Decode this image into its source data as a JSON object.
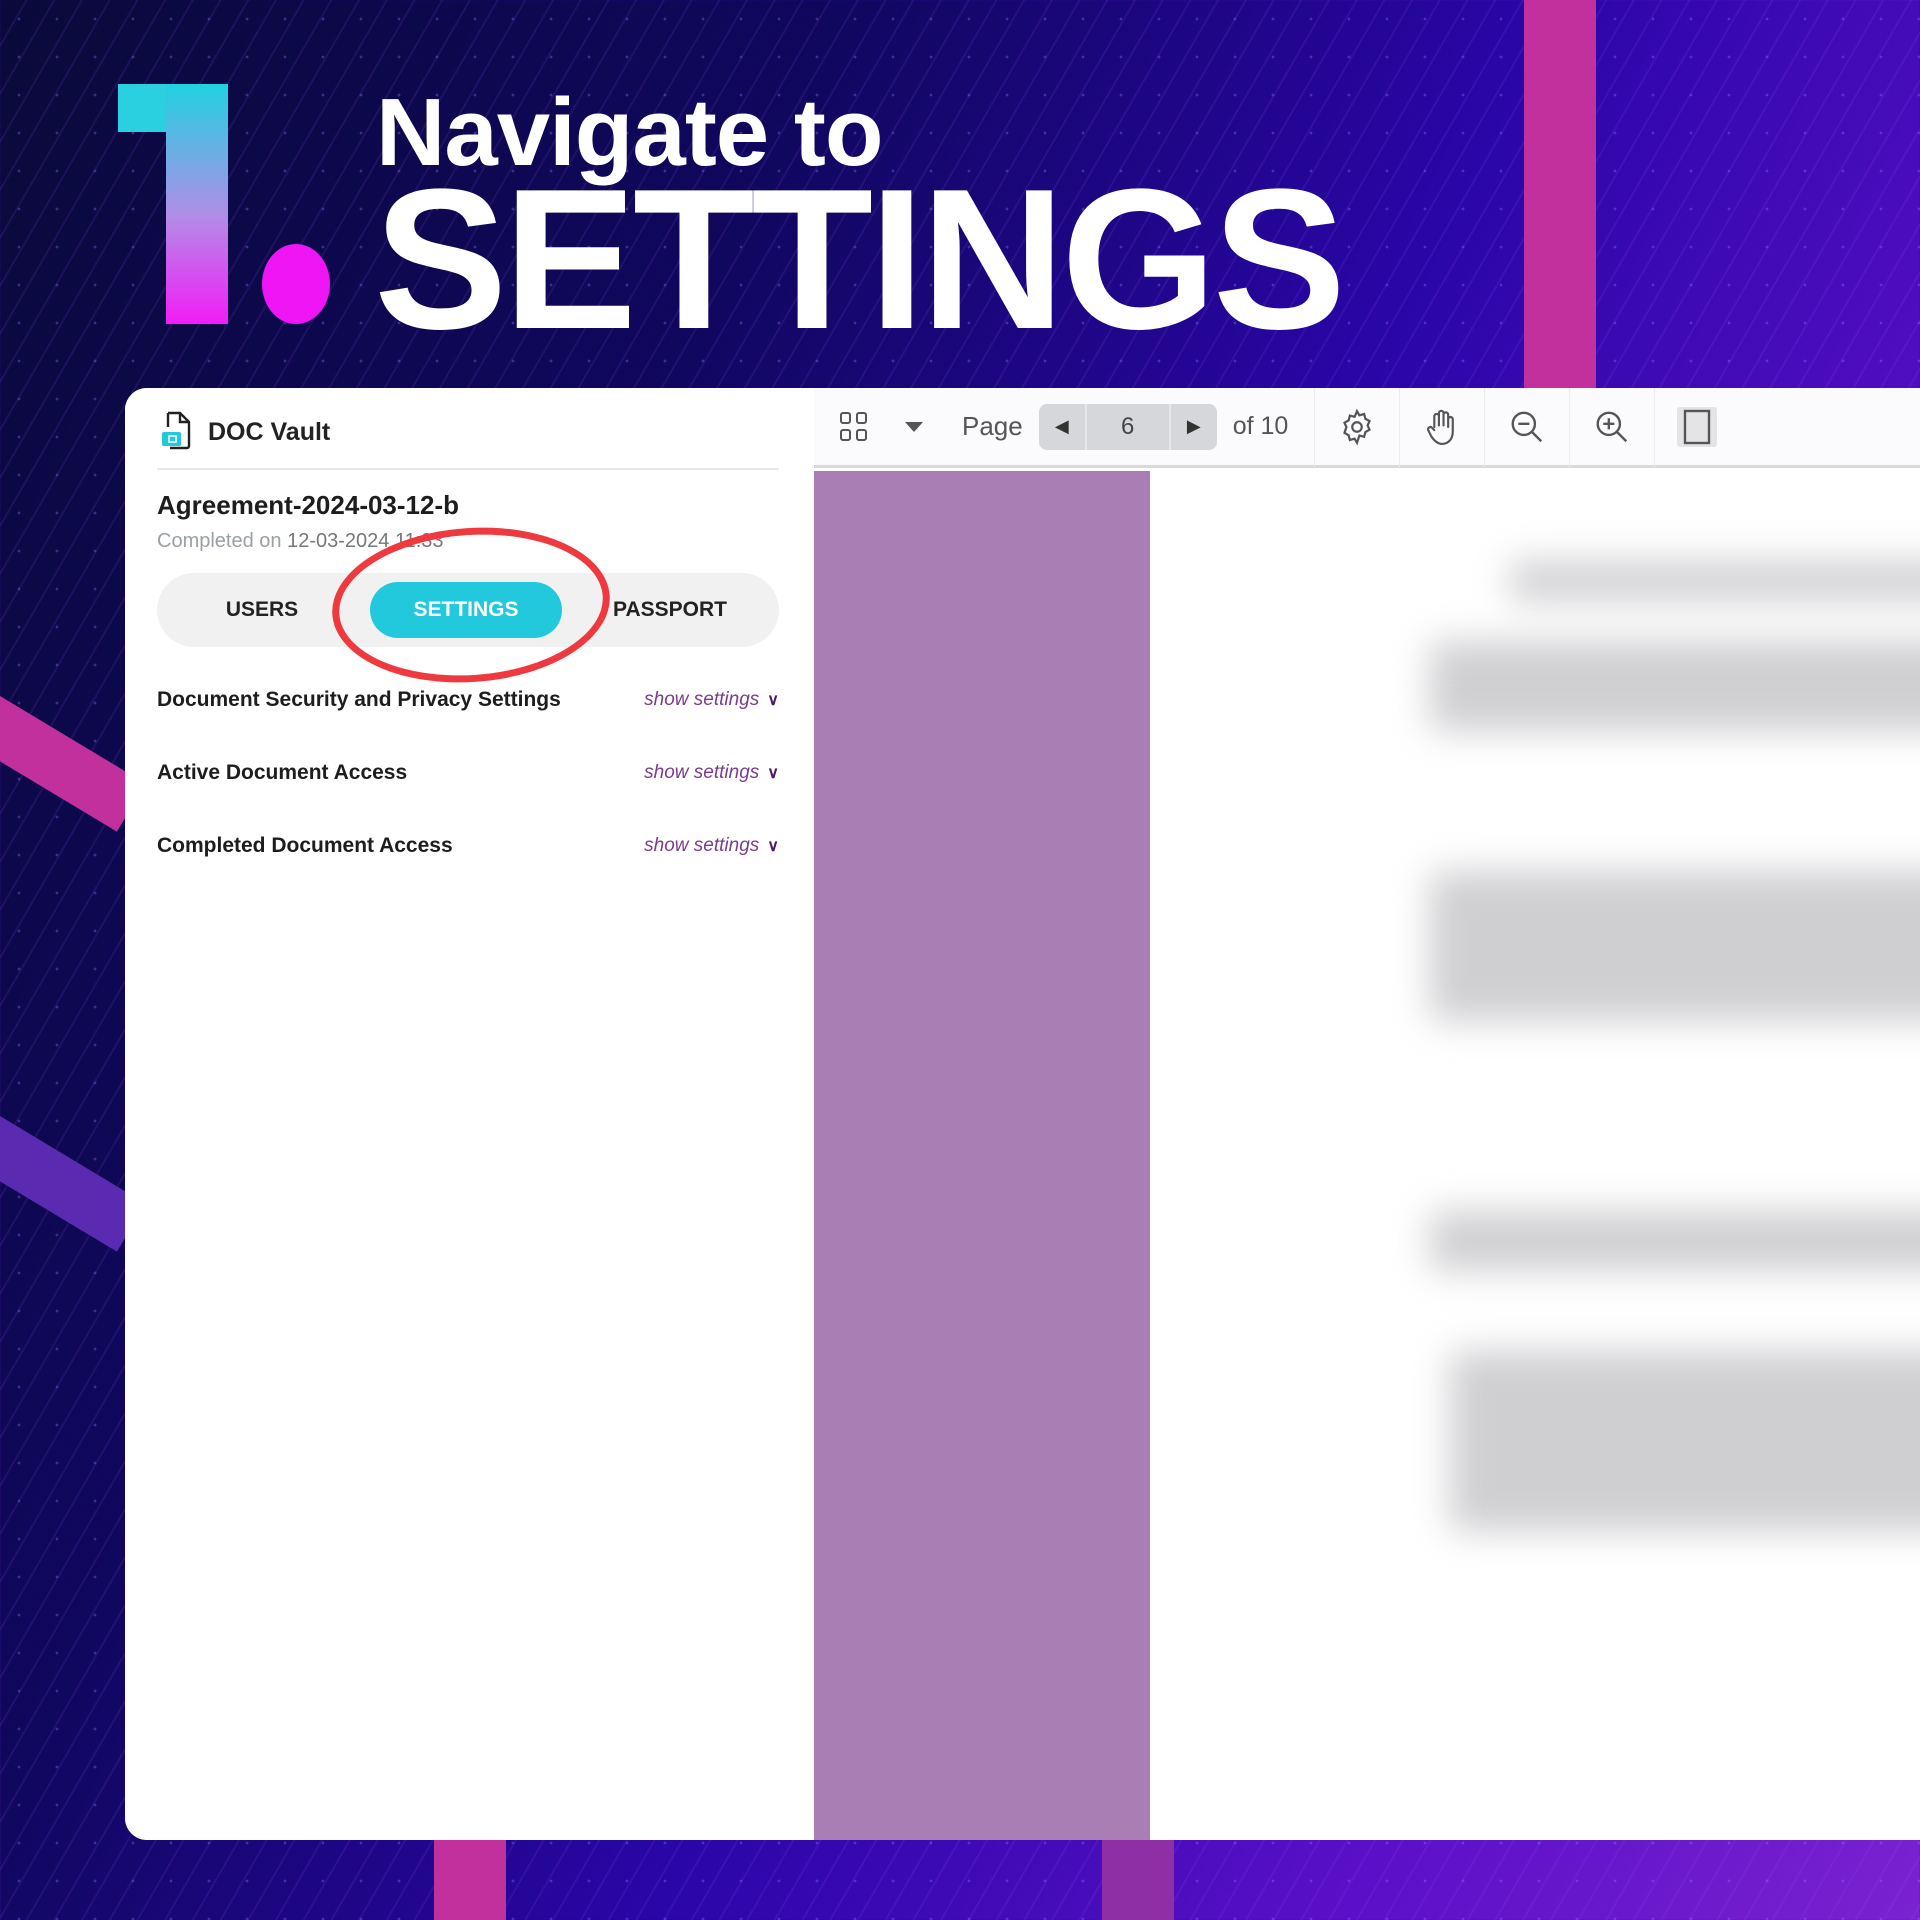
{
  "heading": {
    "number": "1",
    "line1": "Navigate to",
    "line2": "SETTINGS"
  },
  "app": {
    "brand": "DOC Vault",
    "brand_icon": "document-vault-icon",
    "document": {
      "name": "Agreement-2024-03-12-b",
      "completed_label": "Completed on",
      "completed_value": "12-03-2024 11:33"
    },
    "tabs": [
      {
        "label": "USERS",
        "active": false
      },
      {
        "label": "SETTINGS",
        "active": true
      },
      {
        "label": "PASSPORT",
        "active": false
      }
    ],
    "sections": [
      {
        "title": "Document Security and Privacy Settings",
        "link": "show settings"
      },
      {
        "title": "Active Document Access",
        "link": "show settings"
      },
      {
        "title": "Completed Document Access",
        "link": "show settings"
      }
    ],
    "toolbar": {
      "page_label": "Page",
      "current_page": "6",
      "total_label": "of 10",
      "icons": [
        "thumbnails-icon",
        "dropdown-icon",
        "prev-page-icon",
        "next-page-icon",
        "gear-icon",
        "hand-pan-icon",
        "zoom-out-icon",
        "zoom-in-icon",
        "single-page-view-icon"
      ]
    }
  },
  "colors": {
    "accent": "#22c9dc",
    "highlight_circle": "#ee3a3f",
    "link": "#7a3c8c",
    "thumbnail_panel": "#a87eb4"
  }
}
